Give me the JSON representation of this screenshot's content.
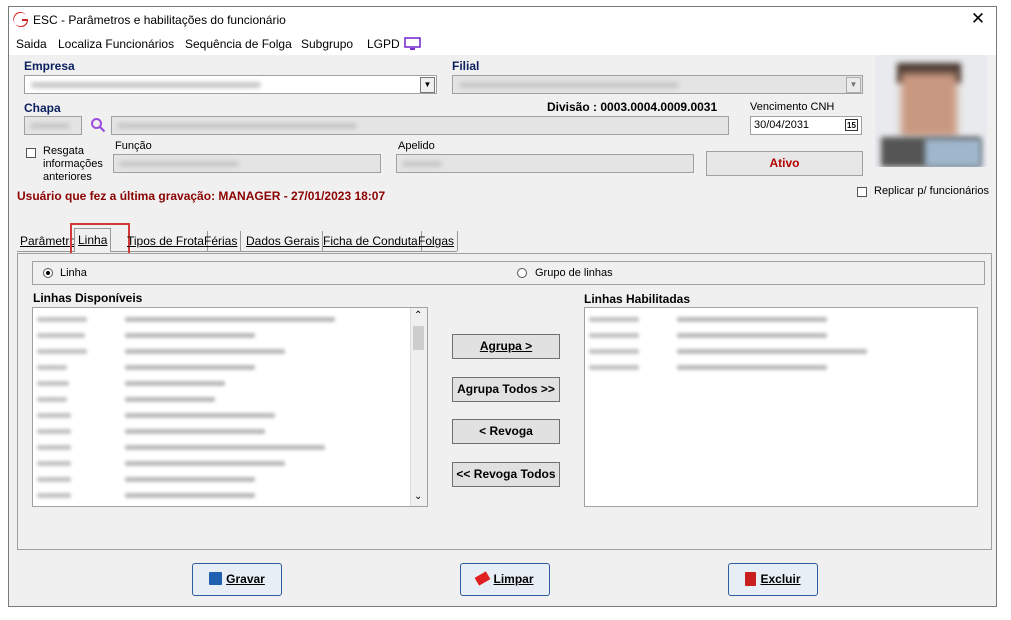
{
  "window": {
    "title": "ESC - Parâmetros e habilitações do funcionário",
    "close_icon": "close-icon"
  },
  "menu": {
    "items": [
      "Saida",
      "Localiza Funcionários",
      "Sequência de Folga",
      "Subgrupo",
      "LGPD"
    ]
  },
  "form": {
    "empresa_label": "Empresa",
    "filial_label": "Filial",
    "chapa_label": "Chapa",
    "divisao": "Divisão : 0003.0004.0009.0031",
    "vencimento_label": "Vencimento  CNH",
    "vencimento_value": "30/04/2031",
    "resgata_label": "Resgata informações anteriores",
    "funcao_label": "Função",
    "apelido_label": "Apelido",
    "status": "Ativo",
    "replicar_label": "Replicar p/ funcionários",
    "last_saved": "Usuário que fez a última gravação: MANAGER - 27/01/2023 18:07"
  },
  "tabs": [
    "Parâmetros",
    "Linha",
    "Tipos de Frota",
    "Férias",
    "Dados Gerais",
    "Ficha de Conduta",
    "Folgas"
  ],
  "linha_tab": {
    "radio_linha": "Linha",
    "radio_grupo": "Grupo de linhas",
    "disponiveis_label": "Linhas Disponíveis",
    "habilitadas_label": "Linhas Habilitadas",
    "btn_agrupa": "Agrupa >",
    "btn_agrupa_todos": "Agrupa Todos >>",
    "btn_revoga": "< Revoga",
    "btn_revoga_todos": "<< Revoga Todos"
  },
  "footer": {
    "gravar": "Gravar",
    "limpar": "Limpar",
    "excluir": "Excluir"
  },
  "colors": {
    "accent_red": "#b30000",
    "brand_red": "#cc2222",
    "dark_navy": "#0a1f5e",
    "lgpd_purple": "#7a2fd0"
  }
}
